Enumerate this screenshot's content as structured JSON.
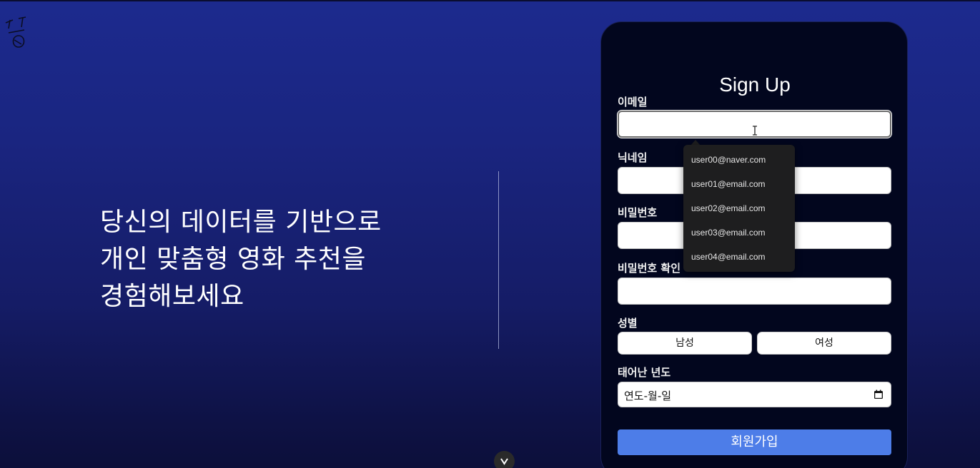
{
  "hero": {
    "lines": [
      "당신의 데이터를 기반으로",
      "개인 맞춤형 영화 추천을",
      "경험해보세요"
    ]
  },
  "signup": {
    "title": "Sign Up",
    "email_label": "이메일",
    "email_value": "",
    "nickname_label": "닉네임",
    "nickname_value": "",
    "password_label": "비밀번호",
    "password_value": "",
    "password_confirm_label": "비밀번호 확인",
    "password_confirm_value": "",
    "gender_label": "성별",
    "gender_male": "남성",
    "gender_female": "여성",
    "birth_year_label": "태어난 년도",
    "birth_date_placeholder": "연도-월-일",
    "submit_label": "회원가입"
  },
  "autocomplete": {
    "options": [
      "user00@naver.com",
      "user01@email.com",
      "user02@email.com",
      "user03@email.com",
      "user04@email.com"
    ]
  },
  "icons": {
    "calendar": "calendar-icon",
    "scroll_down": "chevron-down-icon",
    "text_cursor": "ibeam-cursor-icon"
  },
  "colors": {
    "background_top": "#1c2a8e",
    "background_bottom": "#0c0f3a",
    "card": "#02061e",
    "submit": "#4d7de8",
    "dropdown": "#1e1e1f"
  }
}
